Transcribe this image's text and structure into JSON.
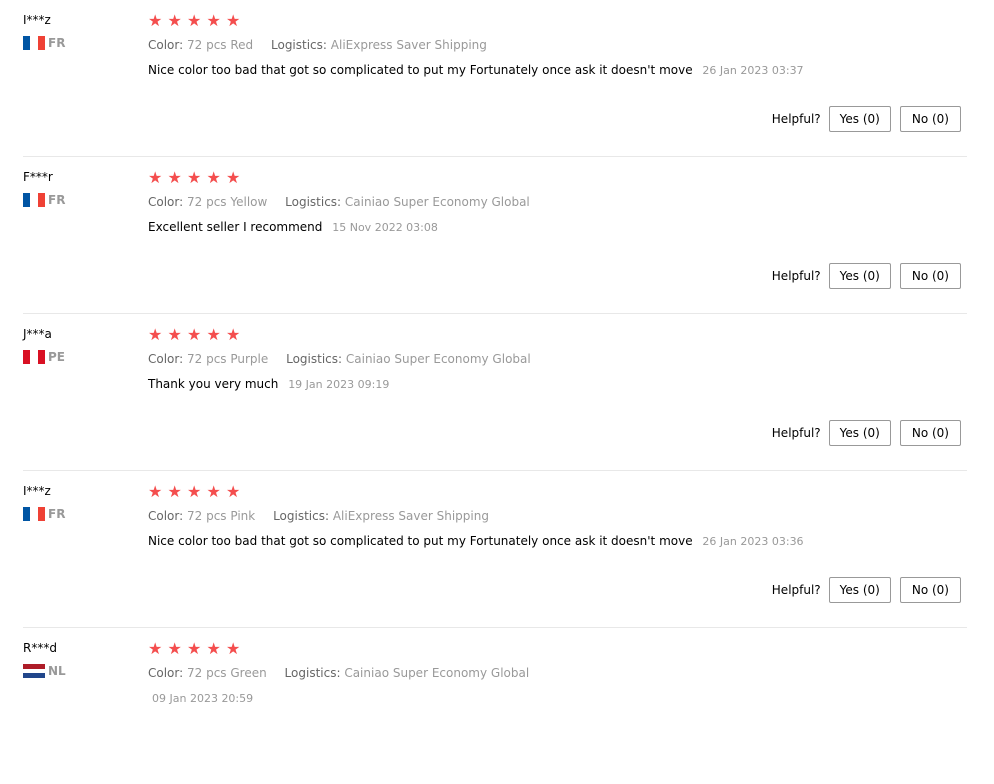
{
  "reviews": [
    {
      "user": "I***z",
      "country": "FR",
      "stars": "★★★★★",
      "color_label": "Color:",
      "color_value": "72 pcs Red",
      "logistics_label": "Logistics:",
      "logistics_value": "AliExpress Saver Shipping",
      "text": "Nice color too bad that got so complicated to put my Fortunately once ask it doesn't move",
      "date": "26 Jan 2023 03:37",
      "helpful_label": "Helpful?",
      "yes_label": "Yes (0)",
      "no_label": "No (0)"
    },
    {
      "user": "F***r",
      "country": "FR",
      "stars": "★★★★★",
      "color_label": "Color:",
      "color_value": "72 pcs Yellow",
      "logistics_label": "Logistics:",
      "logistics_value": "Cainiao Super Economy Global",
      "text": "Excellent seller I recommend",
      "date": "15 Nov 2022 03:08",
      "helpful_label": "Helpful?",
      "yes_label": "Yes (0)",
      "no_label": "No (0)"
    },
    {
      "user": "J***a",
      "country": "PE",
      "stars": "★★★★★",
      "color_label": "Color:",
      "color_value": "72 pcs Purple",
      "logistics_label": "Logistics:",
      "logistics_value": "Cainiao Super Economy Global",
      "text": "Thank you very much",
      "date": "19 Jan 2023 09:19",
      "helpful_label": "Helpful?",
      "yes_label": "Yes (0)",
      "no_label": "No (0)"
    },
    {
      "user": "I***z",
      "country": "FR",
      "stars": "★★★★★",
      "color_label": "Color:",
      "color_value": "72 pcs Pink",
      "logistics_label": "Logistics:",
      "logistics_value": "AliExpress Saver Shipping",
      "text": "Nice color too bad that got so complicated to put my Fortunately once ask it doesn't move",
      "date": "26 Jan 2023 03:36",
      "helpful_label": "Helpful?",
      "yes_label": "Yes (0)",
      "no_label": "No (0)"
    },
    {
      "user": "R***d",
      "country": "NL",
      "stars": "★★★★★",
      "color_label": "Color:",
      "color_value": "72 pcs Green",
      "logistics_label": "Logistics:",
      "logistics_value": "Cainiao Super Economy Global",
      "text": "",
      "date": "09 Jan 2023 20:59"
    }
  ],
  "flag_colors": {
    "FR": [
      "#0055a4",
      "#ffffff",
      "#ef4135"
    ],
    "PE": [
      "#d91023",
      "#ffffff",
      "#d91023"
    ],
    "NL": [
      "#ae1c28",
      "#ffffff",
      "#21468b"
    ]
  },
  "star_color": "#f44e4e"
}
